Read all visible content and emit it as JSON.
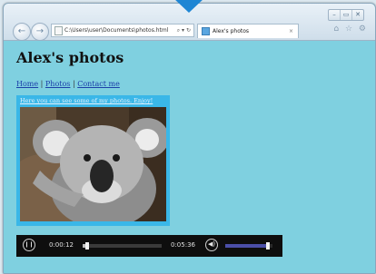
{
  "browser": {
    "address": "C:\\Users\\user\\Documents\\photos.html",
    "address_controls": "⌕ ▾ ↻",
    "tab_title": "Alex's photos",
    "tab_close": "×",
    "window_controls": [
      "–",
      "▭",
      "✕"
    ],
    "toolbar_icons": "⌂ ☆ ⚙",
    "back_glyph": "←",
    "forward_glyph": "→"
  },
  "page": {
    "title": "Alex's photos",
    "nav": [
      "Home",
      "Photos",
      "Contact me"
    ],
    "nav_separator": "|",
    "caption": "Here you can see some of my photos. Enjoy!"
  },
  "video": {
    "play_glyph": "❙❙",
    "current_time": "0:00:12",
    "duration": "0:05:36",
    "progress_fraction": 0.036,
    "volume_glyph": "◀)",
    "volume_fraction": 0.95
  },
  "colors": {
    "page_background": "#7fd0e0",
    "photo_frame": "#3ab7e8",
    "callout_arrow": "#1e86d4",
    "volume_bar": "#4b4fa8"
  },
  "icons": [
    "back-icon",
    "forward-icon",
    "page-icon",
    "favicon-icon",
    "home-icon",
    "star-icon",
    "gear-icon",
    "play-pause-icon",
    "volume-icon"
  ]
}
